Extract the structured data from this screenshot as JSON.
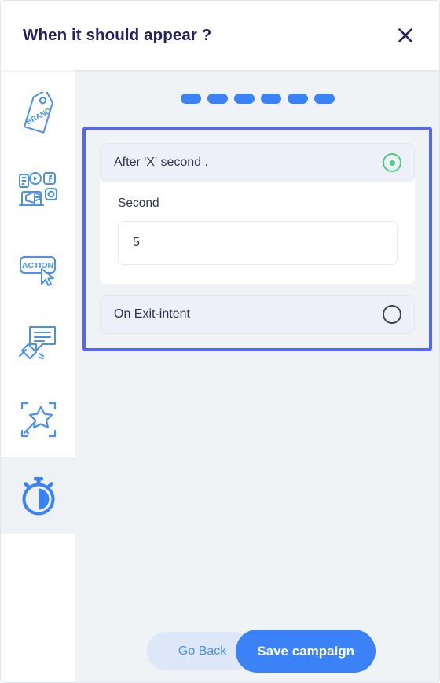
{
  "header": {
    "title": "When it should appear ?",
    "close_icon": "close-icon"
  },
  "sidebar": {
    "items": [
      {
        "icon": "brand-tag-icon",
        "label": "BRAND",
        "active": false
      },
      {
        "icon": "social-media-icon",
        "label": "",
        "active": false
      },
      {
        "icon": "action-button-icon",
        "label": "ACTION",
        "active": false
      },
      {
        "icon": "announcement-icon",
        "label": "",
        "active": false
      },
      {
        "icon": "magic-wand-icon",
        "label": "",
        "active": false
      },
      {
        "icon": "stopwatch-icon",
        "label": "",
        "active": true
      }
    ]
  },
  "stepper": {
    "total": 6,
    "current": 6,
    "dots": [
      true,
      true,
      true,
      true,
      true,
      true
    ]
  },
  "options": [
    {
      "id": "after-x-second",
      "label": "After 'X' second .",
      "selected": true,
      "field": {
        "label": "Second",
        "value": "5",
        "placeholder": "Second"
      }
    },
    {
      "id": "on-exit-intent",
      "label": "On Exit-intent",
      "selected": false
    }
  ],
  "footer": {
    "back_label": "Go Back",
    "save_label": "Save campaign"
  },
  "colors": {
    "accent_blue": "#3b82f6",
    "highlight_border": "#5566f5",
    "selected_green": "#4cd07d",
    "title_navy": "#262261",
    "content_bg": "#eff3f5",
    "option_bg": "#edf0f8"
  }
}
